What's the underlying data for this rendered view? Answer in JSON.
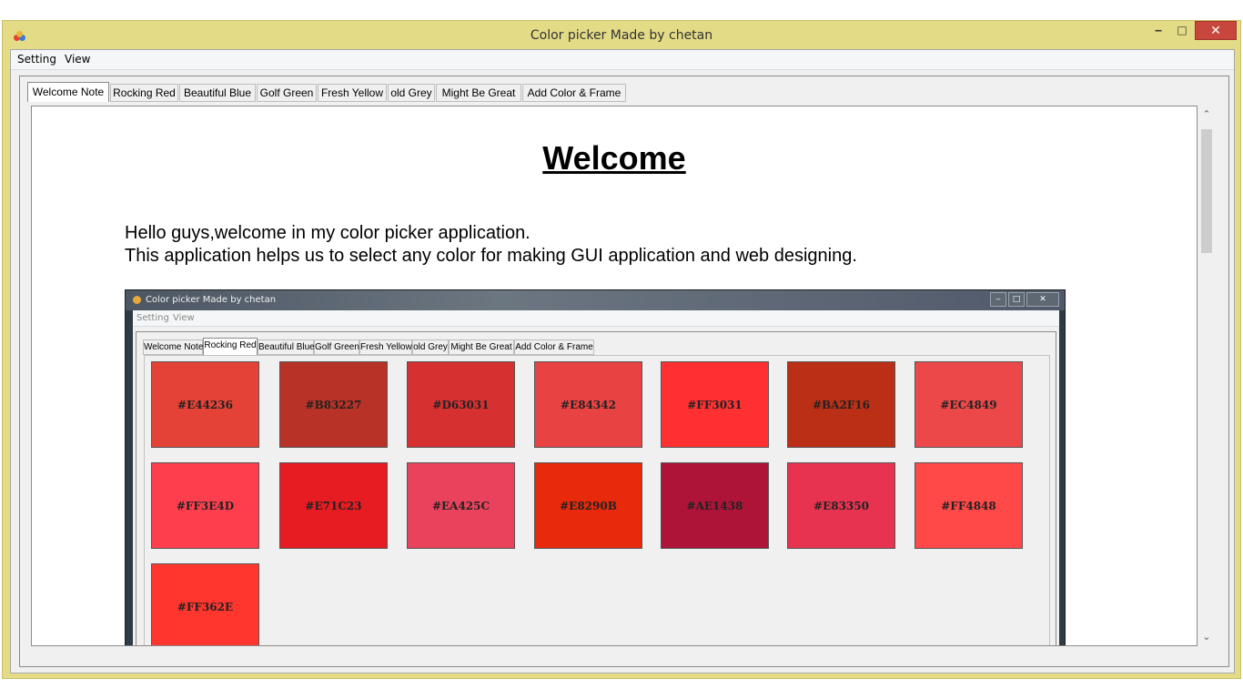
{
  "window": {
    "title": "Color picker Made by chetan",
    "min_label": "‒",
    "max_label": "□",
    "close_label": "✕"
  },
  "menu": [
    "Setting",
    "View"
  ],
  "tabs": [
    "Welcome Note",
    "Rocking Red",
    "Beautiful Blue",
    "Golf Green",
    "Fresh Yellow",
    "old Grey",
    "Might Be Great",
    "Add Color & Frame"
  ],
  "active_tab": "Welcome Note",
  "content": {
    "heading": "Welcome",
    "line1": "Hello guys,welcome in my color picker application.",
    "line2": "This application helps us to select any color for making GUI application and web designing."
  },
  "scrollbar": {
    "up": "⌃",
    "down": "⌄"
  },
  "embedded_screenshot": {
    "title": "Color picker Made by chetan",
    "menu": [
      "Setting",
      "View"
    ],
    "tabs": [
      "Welcome Note",
      "Rocking Red",
      "Beautiful Blue",
      "Golf Green",
      "Fresh Yellow",
      "old Grey",
      "Might Be Great",
      "Add Color & Frame"
    ],
    "active_tab": "Rocking Red",
    "swatches": [
      {
        "label": "#E44236",
        "color": "#E44236"
      },
      {
        "label": "#B83227",
        "color": "#B83227"
      },
      {
        "label": "#D63031",
        "color": "#D63031"
      },
      {
        "label": "#E84342",
        "color": "#E84342"
      },
      {
        "label": "#FF3031",
        "color": "#FF3031"
      },
      {
        "label": "#BA2F16",
        "color": "#BA2F16"
      },
      {
        "label": "#EC4849",
        "color": "#EC4849"
      },
      {
        "label": "#FF3E4D",
        "color": "#FF3E4D"
      },
      {
        "label": "#E71C23",
        "color": "#E71C23"
      },
      {
        "label": "#EA425C",
        "color": "#EA425C"
      },
      {
        "label": "#E8290B",
        "color": "#E8290B"
      },
      {
        "label": "#AE1438",
        "color": "#AE1438"
      },
      {
        "label": "#E83350",
        "color": "#E83350"
      },
      {
        "label": "#FF4848",
        "color": "#FF4848"
      },
      {
        "label": "#FF362E",
        "color": "#FF362E"
      }
    ]
  }
}
